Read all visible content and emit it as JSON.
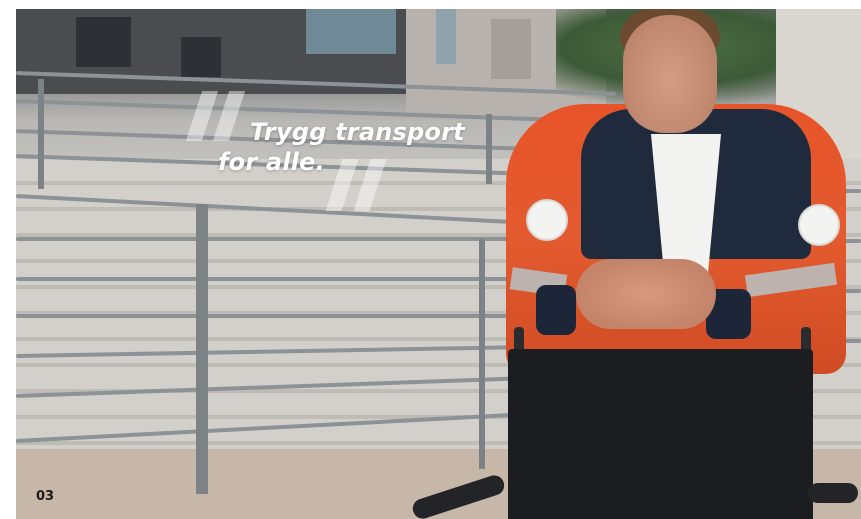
{
  "headline": {
    "line1": "Trygg transport",
    "line2": "for alle."
  },
  "page_number": "03",
  "icons": [
    "open-quote-icon",
    "close-quote-icon"
  ],
  "colors": {
    "headline": "#ffffff",
    "page_number": "#1b1b1b",
    "jacket": "#e8542a",
    "quote_marks": "rgba(255,255,255,0.45)"
  }
}
